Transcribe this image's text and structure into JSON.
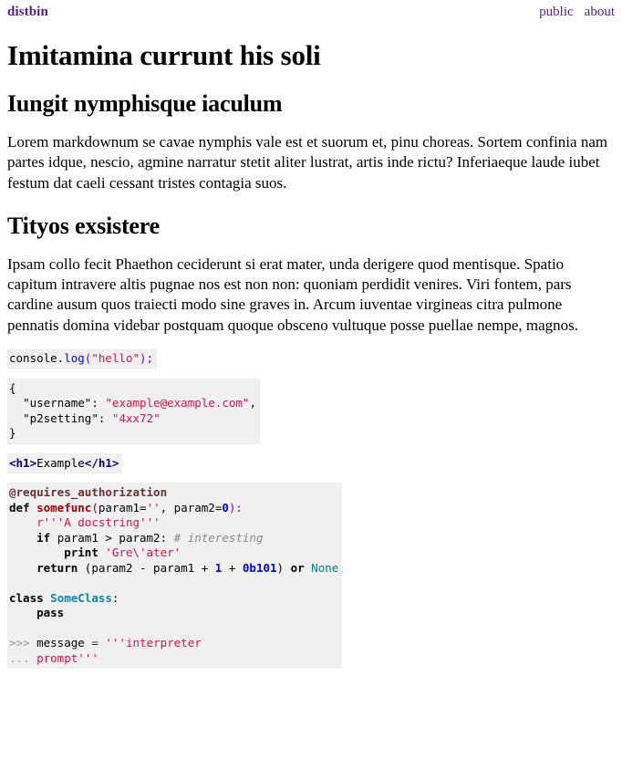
{
  "header": {
    "brand": "distbin",
    "nav": [
      {
        "label": "public"
      },
      {
        "label": "about"
      }
    ]
  },
  "article": {
    "title": "Imitamina currunt his soli",
    "subheading": "Iungit nymphisque iaculum",
    "paragraph1": "Lorem markdownum se cavae nymphis vale est et suorum et, pinu choreas. Sortem confinia nam partes idque, nescio, agmine narratur stetit aliter lustrat, artis inde rictu? Inferiaeque laude iubet festum dat caeli cessant tristes contagia suos.",
    "heading2": "Tityos exsistere",
    "paragraph2": "Ipsam collo fecit Phaethon ceciderunt si erat mater, unda derigere quod mentisque. Spatio capitum intravere altis pugnae nos est non non: quoniam perdidit venires. Viri fontem, pars cardine ausum quos traiecti modo sine graves in. Arcum iuventae virgineas citra pulmone pennatis domina videbar postquam quoque obsceno vultuque posse puellae nempe, magnos."
  },
  "code_blocks": {
    "js": {
      "language": "javascript",
      "text": "console.log(\"hello\");",
      "tokens": [
        {
          "text": "console.",
          "type": "name"
        },
        {
          "text": "log",
          "type": "function"
        },
        {
          "text": "(",
          "type": "punct"
        },
        {
          "text": "\"hello\"",
          "type": "string"
        },
        {
          "text": ")",
          "type": "punct"
        },
        {
          "text": ";",
          "type": "punct"
        }
      ]
    },
    "json": {
      "language": "json",
      "line1": "{",
      "key1": "\"username\"",
      "sep1": ": ",
      "val1": "\"example@example.com\"",
      "comma1": ",",
      "key2": "\"p2setting\"",
      "sep2": ": ",
      "val2": "\"4xx72\"",
      "line4": "}"
    },
    "html": {
      "language": "html",
      "open_tag": "<h1>",
      "content": "Example",
      "close_tag": "</h1>"
    },
    "python": {
      "language": "python",
      "decorator": "@requires_authorization",
      "def_kw": "def",
      "def_name": "somefunc",
      "def_open": "(",
      "def_p1": "param1=",
      "def_p1_val": "''",
      "def_comma": ", ",
      "def_p2": "param2=",
      "def_p2_val": "0",
      "def_close": "):",
      "docstring": "r'''A docstring'''",
      "if_kw": "if",
      "if_expr": " param1 > param2:",
      "comment": "# interesting",
      "print_kw": "print",
      "print_str": "'Gre\\'ater'",
      "return_kw": "return",
      "return_open": " (param2 - param1 + ",
      "return_num1": "1",
      "return_plus": " + ",
      "return_num2": "0b101",
      "return_close": ") ",
      "or_kw": "or",
      "none_kw": "None",
      "class_kw": "class",
      "class_name": "SomeClass",
      "class_colon": ":",
      "pass_kw": "pass",
      "repl_prompt1": ">>> ",
      "repl_var": "message ",
      "repl_eq": "= ",
      "repl_str1": "'''interpreter",
      "repl_prompt2": "... ",
      "repl_str2": "prompt'''"
    }
  },
  "colors": {
    "link": "#551a8b",
    "code_bg": "#f0f0f0",
    "string": "#dd1144",
    "keyword": "#000000",
    "function": "#0000ff",
    "class": "#0e84b5",
    "builtin": "#007f7f",
    "number": "#0000dd",
    "comment": "#8f5902",
    "tag": "#000080",
    "def_name": "#a00000",
    "prompt": "#999999"
  }
}
